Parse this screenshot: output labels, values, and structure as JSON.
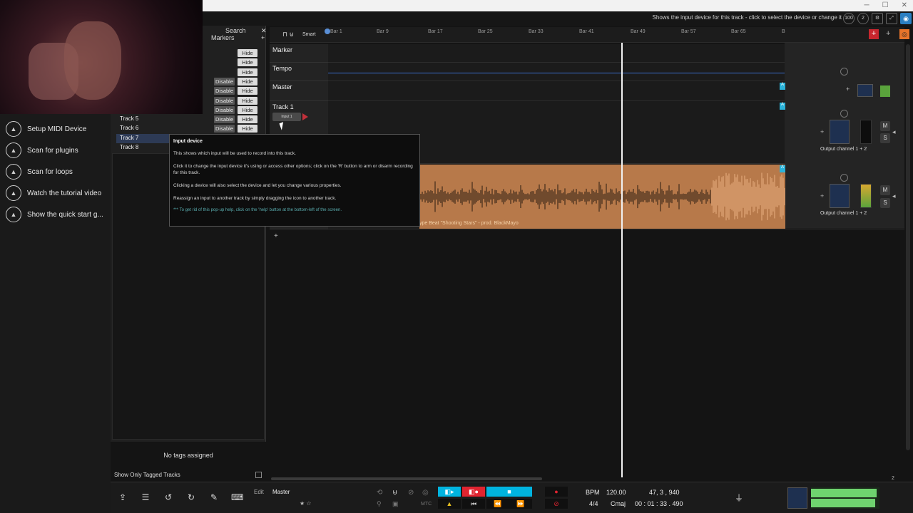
{
  "hint": {
    "text": "Shows the input device for this track - click to select the device or change it",
    "zoom_badge": "100",
    "count_badge": "2"
  },
  "colors": {
    "accent": "#2bb3d9",
    "clip": "#b7794a",
    "record": "#e02430",
    "play_on": "#00b4e0"
  },
  "sidebar": {
    "items": [
      {
        "icon": "graduation-cap-icon",
        "label": "Setup MIDI Device"
      },
      {
        "icon": "graduation-cap-icon",
        "label": "Scan for plugins"
      },
      {
        "icon": "graduation-cap-icon",
        "label": "Scan for loops"
      },
      {
        "icon": "graduation-cap-icon",
        "label": "Watch the tutorial video"
      },
      {
        "icon": "graduation-cap-icon",
        "label": "Show the quick start g..."
      }
    ]
  },
  "tagpanel": {
    "search_label": "Search",
    "markers_label": "Markers",
    "disable_label": "Disable",
    "hide_label": "Hide",
    "rows": [
      {
        "name": "",
        "disable": false
      },
      {
        "name": "",
        "disable": false
      },
      {
        "name": "",
        "disable": false
      },
      {
        "name": "",
        "disable": true
      },
      {
        "name": "",
        "disable": true
      },
      {
        "name": "",
        "disable": true
      },
      {
        "name": "",
        "disable": true
      },
      {
        "name": "Track 5",
        "disable": true
      },
      {
        "name": "Track 6",
        "disable": true
      },
      {
        "name": "Track 7",
        "disable": false
      },
      {
        "name": "Track 8",
        "disable": false
      }
    ],
    "no_tags": "No tags assigned",
    "show_only_tagged": "Show Only Tagged Tracks"
  },
  "ruler": {
    "smart_label": "Smart",
    "bars": [
      "Bar 1",
      "Bar 9",
      "Bar 17",
      "Bar 25",
      "Bar 33",
      "Bar 41",
      "Bar 49",
      "Bar 57",
      "Bar 65",
      "B"
    ]
  },
  "tracks": {
    "marker": "Marker",
    "tempo": "Tempo",
    "master": "Master",
    "track1": "Track 1",
    "input_chip": "Input 1"
  },
  "mixer": {
    "output_label": "Output channel 1 + 2",
    "mute": "M",
    "solo": "S"
  },
  "clip": {
    "name": "ype Beat \"Shooting Stars\" - prod. BlackMayo"
  },
  "popup": {
    "title": "Input device",
    "p1": "This shows which input will be used to record into this track.",
    "p2": "Click it to change the input device it's using or access other options; click on the 'R' button to arm or disarm recording for this track.",
    "p3": "Clicking a device will also select the device and let you change various properties.",
    "p4": "Reassign an input to another track by simply dragging the icon to another track.",
    "p5": "*** To get rid of this pop-up help, click on the 'help' button at the bottom-left of the screen."
  },
  "bottom": {
    "edit_label": "Edit",
    "edit_target": "Master",
    "bpm_label": "BPM",
    "bpm_value": "120.00",
    "position_bars": "47,  3 ,  940",
    "time_sig": "4/4",
    "key": "Cmaj",
    "position_time": "00 : 01 : 33 . 490",
    "mtc": "MTC",
    "zoom_page": "2"
  }
}
